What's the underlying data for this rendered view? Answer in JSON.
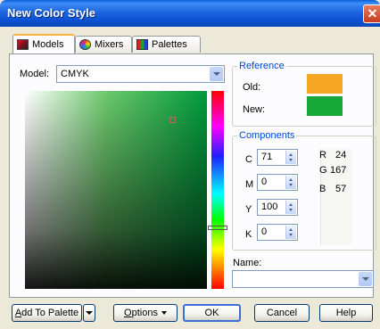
{
  "window": {
    "title": "New Color Style"
  },
  "tabs": [
    {
      "label": "Models",
      "icon": "models-icon"
    },
    {
      "label": "Mixers",
      "icon": "mixers-icon"
    },
    {
      "label": "Palettes",
      "icon": "palettes-icon"
    }
  ],
  "model": {
    "label": "Model:",
    "value": "CMYK"
  },
  "reference": {
    "legend": "Reference",
    "old_label": "Old:",
    "new_label": "New:",
    "old_color": "#f5a623",
    "new_color": "#18a739"
  },
  "components": {
    "legend": "Components",
    "cmyk": [
      {
        "label": "C",
        "value": "71"
      },
      {
        "label": "M",
        "value": "0"
      },
      {
        "label": "Y",
        "value": "100"
      },
      {
        "label": "K",
        "value": "0"
      }
    ],
    "rgb": [
      {
        "label": "R",
        "value": "24"
      },
      {
        "label": "G",
        "value": "167"
      },
      {
        "label": "B",
        "value": "57"
      }
    ]
  },
  "name": {
    "label": "Name:",
    "value": ""
  },
  "buttons": {
    "add_to_palette_a": "A",
    "add_to_palette_b": "dd To Palette",
    "options_a": "O",
    "options_b": "ptions",
    "ok": "OK",
    "cancel": "Cancel",
    "help": "Help"
  },
  "close_glyph": "✕"
}
